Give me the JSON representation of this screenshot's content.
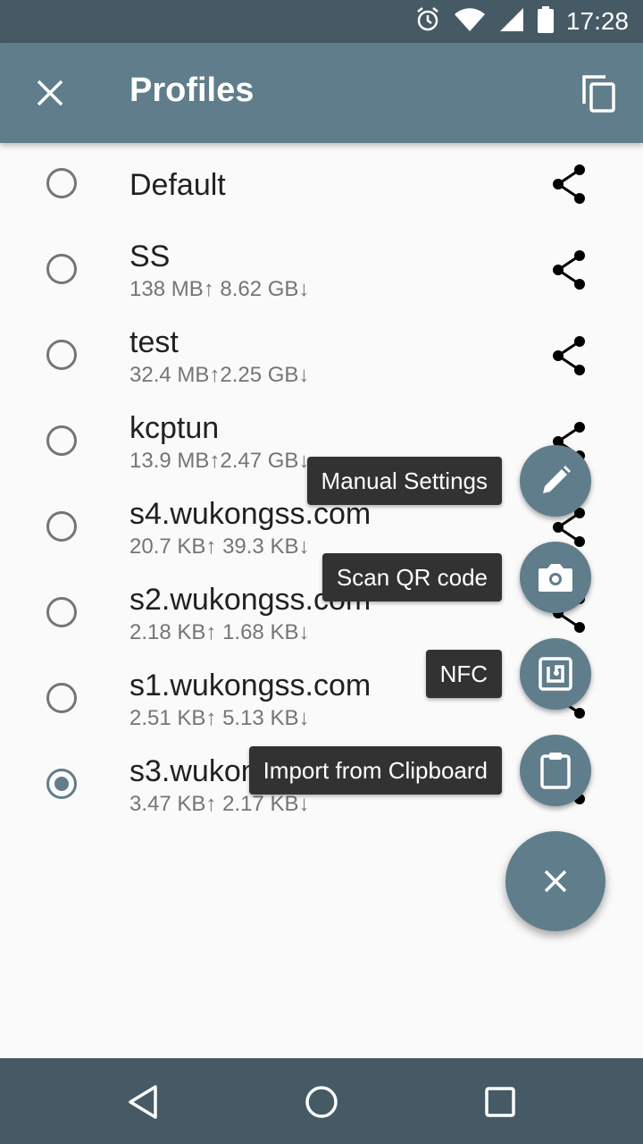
{
  "status_bar": {
    "time": "17:28",
    "icons": [
      "alarm-icon",
      "wifi-icon",
      "signal-icon",
      "battery-icon"
    ]
  },
  "app_bar": {
    "title": "Profiles",
    "close_icon": "close-icon",
    "copy_icon": "copy-icon",
    "background": "#607d8b"
  },
  "profiles": [
    {
      "name": "Default",
      "traffic": "",
      "selected": false
    },
    {
      "name": "SS",
      "traffic": "138 MB↑ 8.62 GB↓",
      "selected": false
    },
    {
      "name": "test",
      "traffic": "32.4 MB↑2.25 GB↓",
      "selected": false
    },
    {
      "name": "kcptun",
      "traffic": "13.9 MB↑2.47 GB↓",
      "selected": false
    },
    {
      "name": "s4.wukongss.com",
      "traffic": "20.7 KB↑ 39.3 KB↓",
      "selected": false
    },
    {
      "name": "s2.wukongss.com",
      "traffic": "2.18 KB↑ 1.68 KB↓",
      "selected": false
    },
    {
      "name": "s1.wukongss.com",
      "traffic": "2.51 KB↑ 5.13 KB↓",
      "selected": false
    },
    {
      "name": "s3.wukongss.com",
      "traffic": "3.47 KB↑ 2.17 KB↓",
      "selected": true
    }
  ],
  "fab_menu": [
    {
      "label": "Manual Settings",
      "icon": "pencil-icon"
    },
    {
      "label": "Scan QR code",
      "icon": "camera-icon"
    },
    {
      "label": "NFC",
      "icon": "nfc-icon"
    },
    {
      "label": "Import from Clipboard",
      "icon": "clipboard-icon"
    }
  ],
  "main_fab": {
    "icon": "close-icon"
  },
  "nav_bar": {
    "icons": [
      "back-icon",
      "home-icon",
      "recents-icon"
    ]
  },
  "colors": {
    "primary": "#607d8b",
    "primary_dark": "#455a64",
    "tooltip": "#323232"
  }
}
